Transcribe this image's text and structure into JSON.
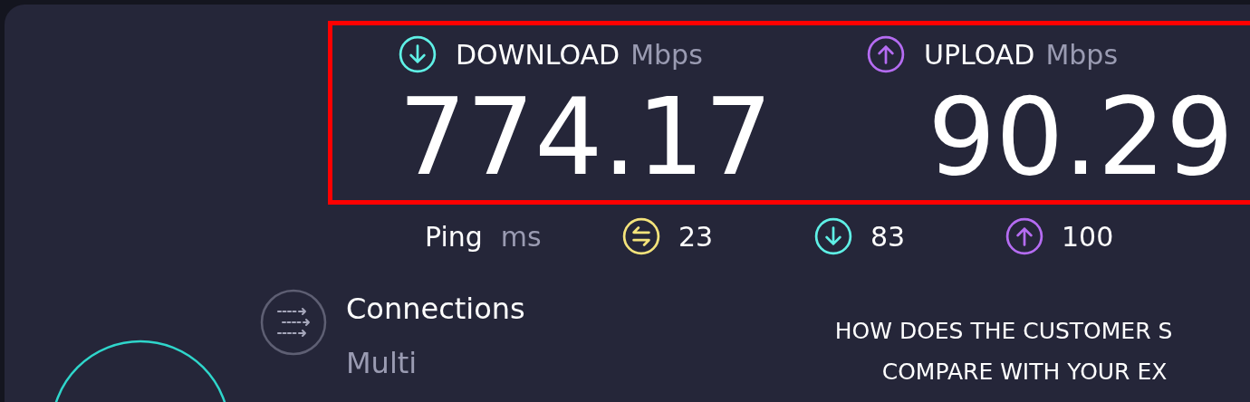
{
  "results": [
    {
      "kind": "download",
      "label": "DOWNLOAD",
      "unit": "Mbps",
      "value": "774.17"
    },
    {
      "kind": "upload",
      "label": "UPLOAD",
      "unit": "Mbps",
      "value": "90.29"
    }
  ],
  "ping": {
    "label": "Ping",
    "unit": "ms",
    "stats": [
      {
        "kind": "idle",
        "value": "23"
      },
      {
        "kind": "download",
        "value": "83"
      },
      {
        "kind": "upload",
        "value": "100"
      }
    ]
  },
  "connections": {
    "label": "Connections",
    "value": "Multi"
  },
  "survey": {
    "lines": [
      "HOW DOES THE CUSTOMER S",
      "COMPARE WITH YOUR EX"
    ]
  }
}
